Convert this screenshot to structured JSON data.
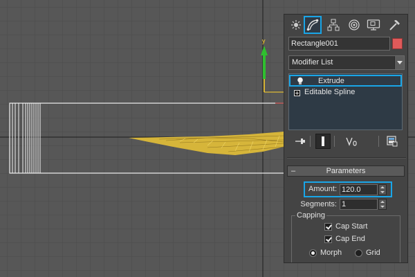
{
  "object_name": "Rectangle001",
  "object_color": "#e05a5a",
  "modifier_list": "Modifier List",
  "stack": [
    {
      "label": "Extrude",
      "selected": true
    },
    {
      "label": "Editable Spline",
      "selected": false
    }
  ],
  "command_tabs": [
    "create-tab",
    "modify-tab",
    "hierarchy-tab",
    "motion-tab",
    "display-tab",
    "utilities-tab"
  ],
  "parameters": {
    "title": "Parameters",
    "amount_label": "Amount:",
    "amount_value": "120.0",
    "segments_label": "Segments:",
    "segments_value": "1",
    "capping_title": "Capping",
    "cap_start": "Cap Start",
    "cap_end": "Cap End",
    "morph": "Morph",
    "grid": "Grid"
  },
  "colors": {
    "accent": "#19a6e8",
    "viewport_bg": "#575757",
    "y_axis": "#2fbf2f",
    "mesh": "#d6b53a"
  },
  "gizmo": {
    "axis_label": "y"
  }
}
